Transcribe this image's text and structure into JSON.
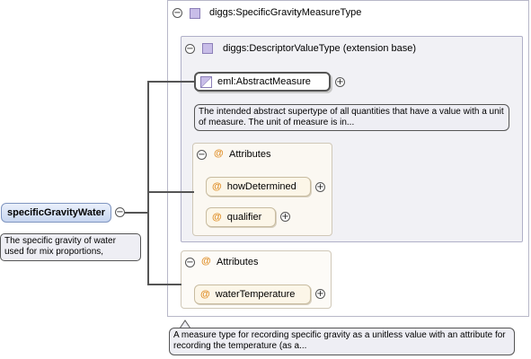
{
  "root_element": {
    "name": "specificGravityWater",
    "doc": "The specific gravity of water used for mix proportions,"
  },
  "outer_type": {
    "name": "diggs:SpecificGravityMeasureType",
    "doc": "A measure type for recording specific gravity as a unitless value with an attribute for recording the temperature (as a..."
  },
  "extension": {
    "name": "diggs:DescriptorValueType (extension base)",
    "abstract_measure": {
      "name": "eml:AbstractMeasure",
      "doc": "The intended abstract supertype of all quantities that have a value with a unit of measure. The unit of measure is in..."
    },
    "attributes_group": {
      "label": "Attributes",
      "items": [
        "howDetermined",
        "qualifier"
      ]
    }
  },
  "own_attributes": {
    "label": "Attributes",
    "items": [
      "waterTemperature"
    ]
  },
  "icons": {
    "toggle_collapse": "⊖",
    "toggle_expand": "⊕",
    "attribute": "@",
    "complex_type": "complex-type-icon",
    "abstract": "abstract-element-icon"
  },
  "colors": {
    "root_fill": "#c7d6f0",
    "attribute_icon": "#e0902a",
    "type_icon": "#c8bde8"
  }
}
